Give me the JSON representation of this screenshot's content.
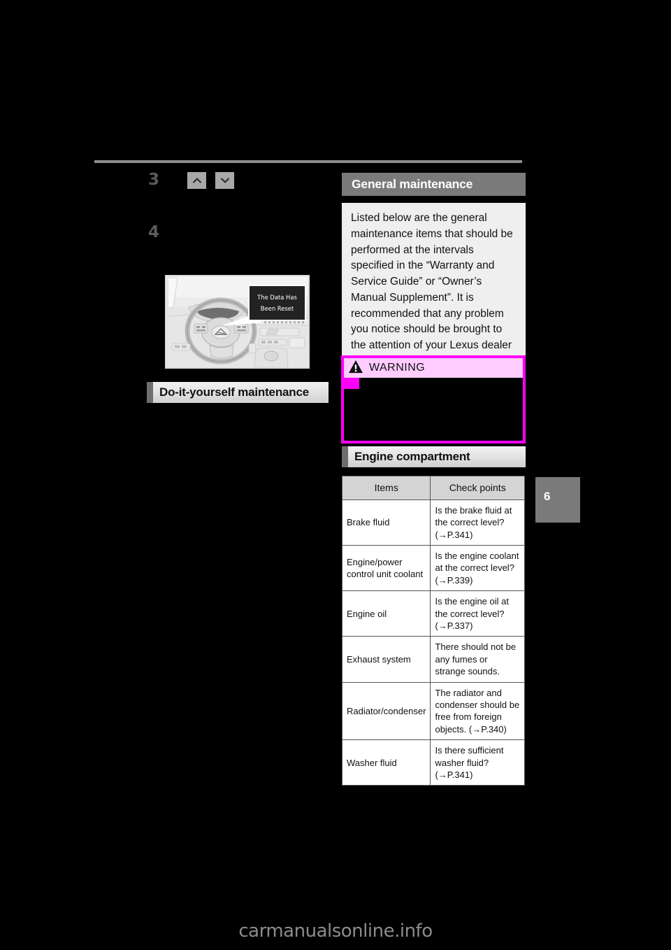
{
  "page": {
    "chapter_tab": "6",
    "watermark": "carmanualsonline.info"
  },
  "left_column": {
    "steps": [
      {
        "number": "3",
        "text": ""
      },
      {
        "number": "4",
        "text": ""
      }
    ],
    "arrow_buttons": [
      {
        "icon": "chevron-up-icon"
      },
      {
        "icon": "chevron-down-icon"
      }
    ],
    "illustration": {
      "caption_line1": "The Data Has",
      "caption_line2": "Been Reset",
      "alt": "steering-wheel-and-dashboard-illustration"
    },
    "section_heading": "Do-it-yourself maintenance"
  },
  "right_column": {
    "general_maintenance": {
      "title": "General maintenance",
      "body": "Listed below are the general maintenance items that should be performed at the intervals specified in the “Warranty and Service Guide” or “Owner’s Manual Supplement”. It is recommended that any problem you notice should be brought to the attention of your Lexus dealer or qualified service shop for advice."
    },
    "warning": {
      "label": "WARNING",
      "icon": "warning-triangle-icon",
      "body": ""
    },
    "engine_compartment": {
      "title": "Engine compartment",
      "columns": [
        "Items",
        "Check points"
      ],
      "rows": [
        {
          "item": "Brake fluid",
          "check": "Is the brake fluid at the correct level? (→P.341)"
        },
        {
          "item": "Engine/power control unit coolant",
          "check": "Is the engine coolant at the correct level? (→P.339)"
        },
        {
          "item": "Engine oil",
          "check": "Is the engine oil at the correct level? (→P.337)"
        },
        {
          "item": "Exhaust system",
          "check": "There should not be any fumes or strange sounds."
        },
        {
          "item": "Radiator/condenser",
          "check": "The radiator and condenser should be free from foreign objects. (→P.340)"
        },
        {
          "item": "Washer fluid",
          "check": "Is there sufficient washer fluid? (→P.341)"
        }
      ]
    }
  },
  "colors": {
    "page_background": "#000000",
    "heading_gray": "#7a7a7a",
    "warning_border": "#ff00ff",
    "warning_header": "#ffccff",
    "table_header": "#d4d4d4",
    "body_panel": "#efefef"
  }
}
